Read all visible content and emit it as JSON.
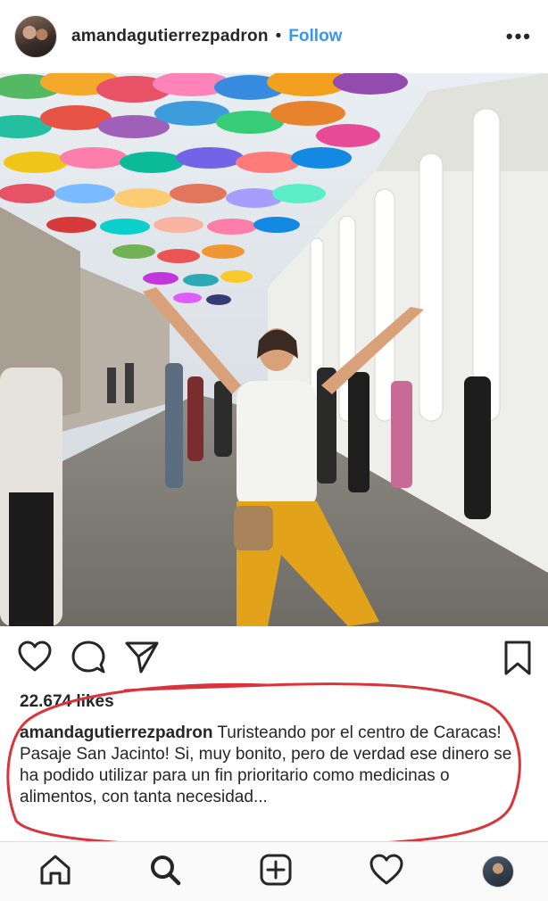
{
  "post": {
    "username": "amandagutierrezpadron",
    "separator": "•",
    "follow_label": "Follow",
    "more_label": "•••",
    "likes": "22.674 likes",
    "caption_user": "amandagutierrezpadron",
    "caption_text": " Turisteando por el centro de Caracas! Pasaje San Jacinto!  Si, muy bonito, pero de verdad ese dinero se ha podido utilizar para un fin prioritario como medicinas o alimentos, con tanta necesidad..."
  },
  "icons": {
    "like": "heart-outline",
    "comment": "speech-bubble",
    "share": "paper-plane",
    "save": "bookmark",
    "more": "ellipsis"
  },
  "tabbar": {
    "items": [
      "home",
      "search",
      "new-post",
      "activity",
      "profile"
    ]
  },
  "colors": {
    "follow": "#3897f0",
    "text": "#262626",
    "annotation": "#d9343a",
    "divider": "#dbdbdb"
  }
}
